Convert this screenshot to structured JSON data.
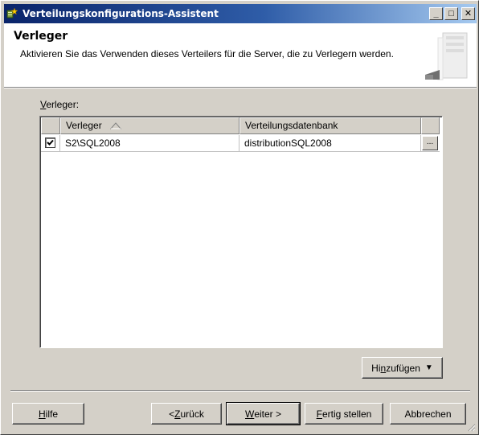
{
  "window": {
    "title": "Verteilungskonfigurations-Assistent",
    "controls": {
      "minimize": "_",
      "maximize": "□",
      "close": "✕"
    }
  },
  "header": {
    "title": "Verleger",
    "description": "Aktivieren Sie das Verwenden dieses Verteilers für die Server, die zu Verlegern werden."
  },
  "publishers": {
    "label_mnemonic": "V",
    "label_rest": "erleger:",
    "columns": [
      "Verleger",
      "Verteilungsdatenbank"
    ],
    "sort_column": "Verleger",
    "rows": [
      {
        "checked": true,
        "publisher": "S2\\SQL2008",
        "database": "distributionSQL2008",
        "browse_label": "..."
      }
    ]
  },
  "add_button": {
    "pre": "Hi",
    "mnemonic": "n",
    "post": "zufügen",
    "arrow": "▼"
  },
  "buttons": {
    "help": {
      "mnemonic": "H",
      "rest": "ilfe"
    },
    "back": {
      "pre": "< ",
      "mnemonic": "Z",
      "rest": "urück"
    },
    "next": {
      "mnemonic": "W",
      "rest": "eiter >"
    },
    "finish": {
      "mnemonic": "F",
      "rest": "ertig stellen"
    },
    "cancel": {
      "label": "Abbrechen"
    }
  },
  "colors": {
    "titlebar_start": "#0a246a",
    "titlebar_end": "#a6caf0",
    "face": "#d4d0c8"
  }
}
